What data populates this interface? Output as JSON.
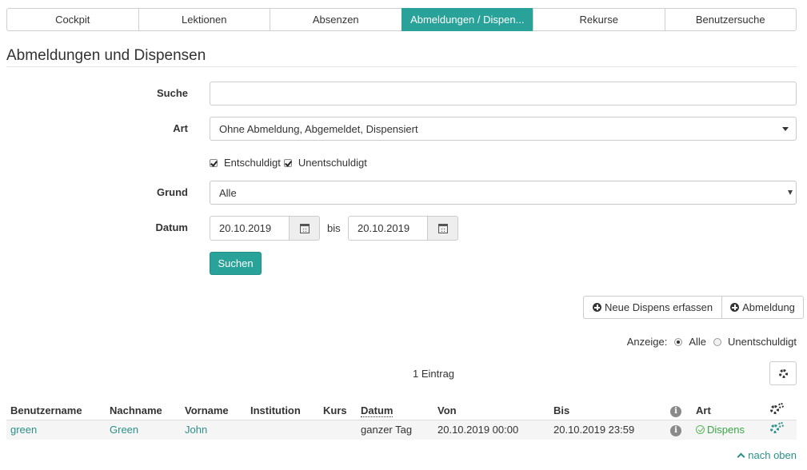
{
  "tabs": [
    {
      "label": "Cockpit",
      "active": false
    },
    {
      "label": "Lektionen",
      "active": false
    },
    {
      "label": "Absenzen",
      "active": false
    },
    {
      "label": "Abmeldungen / Dispen...",
      "active": true
    },
    {
      "label": "Rekurse",
      "active": false
    },
    {
      "label": "Benutzersuche",
      "active": false
    }
  ],
  "page_title": "Abmeldungen und Dispensen",
  "form": {
    "suche_label": "Suche",
    "suche_value": "",
    "art_label": "Art",
    "art_value": "Ohne Abmeldung, Abgemeldet, Dispensiert",
    "checkbox_entschuldigt": "Entschuldigt",
    "checkbox_unentschuldigt": "Unentschuldigt",
    "grund_label": "Grund",
    "grund_value": "Alle",
    "datum_label": "Datum",
    "datum_from": "20.10.2019",
    "bis_label": "bis",
    "datum_to": "20.10.2019",
    "suchen_button": "Suchen"
  },
  "actions": {
    "neue_dispens": "Neue Dispens erfassen",
    "abmeldung": "Abmeldung"
  },
  "anzeige": {
    "label": "Anzeige:",
    "alle": "Alle",
    "unentschuldigt": "Unentschuldigt",
    "selected": "Alle"
  },
  "result_count": "1 Eintrag",
  "table": {
    "headers": {
      "benutzername": "Benutzername",
      "nachname": "Nachname",
      "vorname": "Vorname",
      "institution": "Institution",
      "kurs": "Kurs",
      "datum": "Datum",
      "von": "Von",
      "bis": "Bis",
      "art": "Art"
    },
    "rows": [
      {
        "benutzername": "green",
        "nachname": "Green",
        "vorname": "John",
        "institution": "",
        "kurs": "",
        "datum": "ganzer Tag",
        "von": "20.10.2019 00:00",
        "bis": "20.10.2019 23:59",
        "art": "Dispens"
      }
    ]
  },
  "back_to_top": "nach oben",
  "colors": {
    "accent": "#29a39a",
    "link": "#2a9088",
    "success": "#3aa545"
  }
}
